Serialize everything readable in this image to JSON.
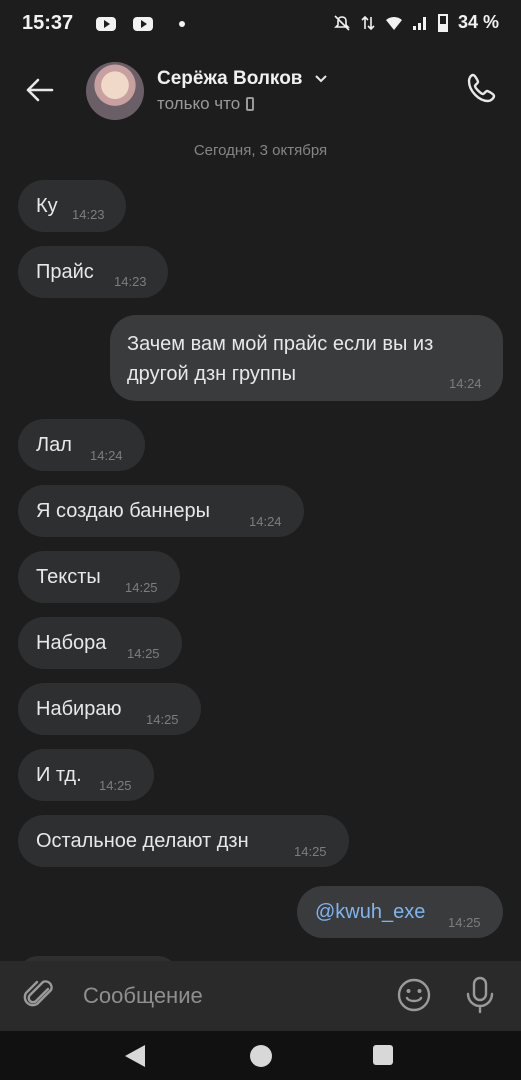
{
  "status_bar": {
    "time": "15:37",
    "battery": "34 %"
  },
  "header": {
    "contact_name": "Серёжа Волков",
    "status": "только что"
  },
  "date_separator": "Сегодня, 3 октября",
  "messages": [
    {
      "text": "Ку",
      "time": "14:23",
      "direction": "in"
    },
    {
      "text": "Прайс",
      "time": "14:23",
      "direction": "in"
    },
    {
      "text": "Зачем вам мой прайс если вы из другой дзн группы",
      "time": "14:24",
      "direction": "out"
    },
    {
      "text": "Лал",
      "time": "14:24",
      "direction": "in"
    },
    {
      "text": "Я создаю баннеры",
      "time": "14:24",
      "direction": "in"
    },
    {
      "text": "Тексты",
      "time": "14:25",
      "direction": "in"
    },
    {
      "text": "Набора",
      "time": "14:25",
      "direction": "in"
    },
    {
      "text": "Набираю",
      "time": "14:25",
      "direction": "in"
    },
    {
      "text": "И тд.",
      "time": "14:25",
      "direction": "in"
    },
    {
      "text": "Остальное делают дзн",
      "time": "14:25",
      "direction": "in"
    },
    {
      "text": "@kwuh_exe",
      "time": "14:25",
      "direction": "out"
    }
  ],
  "composer": {
    "placeholder": "Сообщение"
  },
  "colors": {
    "background": "#1d1d1e",
    "bubble_in": "#2e2f30",
    "bubble_out": "#3a3b3d",
    "mention": "#7fb4f0"
  }
}
